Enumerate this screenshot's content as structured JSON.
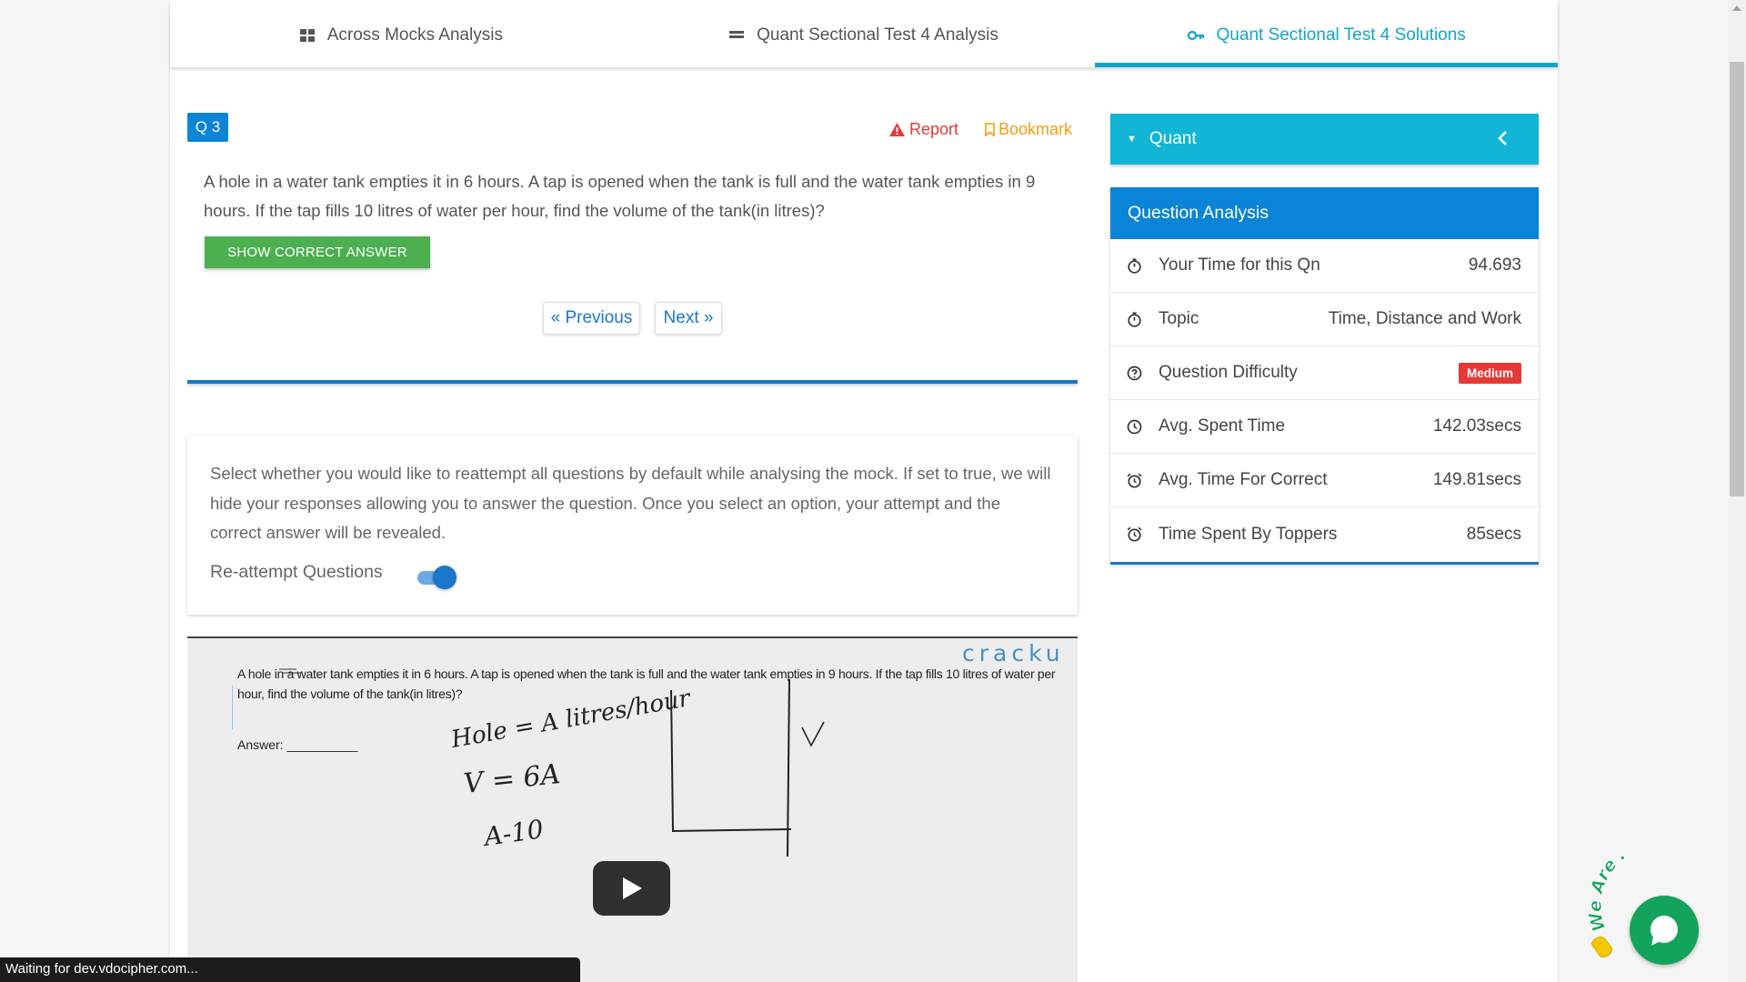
{
  "tabs": [
    {
      "label": "Across Mocks Analysis",
      "icon": "grid-icon"
    },
    {
      "label": "Quant Sectional Test 4 Analysis",
      "icon": "list-icon"
    },
    {
      "label": "Quant Sectional Test 4 Solutions",
      "icon": "key-icon",
      "active": true
    }
  ],
  "question": {
    "number": "Q 3",
    "report_label": "Report",
    "bookmark_label": "Bookmark",
    "text": "A hole in a water tank empties it in 6 hours. A tap is opened when the tank is full and the water tank empties in 9 hours. If the tap fills 10 litres of water per hour, find the volume of the tank(in litres)?",
    "show_answer_label": "SHOW CORRECT ANSWER",
    "prev_label": "« Previous",
    "next_label": "Next »"
  },
  "reattempt": {
    "description": "Select whether you would like to reattempt all questions by default while analysing the mock. If set to true, we will hide your responses allowing you to answer the question. Once you select an option, your attempt and the correct answer will be revealed.",
    "label": "Re-attempt Questions",
    "enabled": true
  },
  "video": {
    "logo": "cracku",
    "question_text": "A hole in a water tank empties it in 6 hours. A tap is opened when the tank is full and the water tank empties in 9 hours. If the tap fills 10 litres of water per hour, find the volume of the tank(in litres)?",
    "answer_label": "Answer: __________",
    "handwriting": [
      "Hole = A litres/hour",
      "V = 6A",
      "A-10",
      "V"
    ]
  },
  "sidebar": {
    "section_label": "Quant",
    "analysis_title": "Question Analysis",
    "rows": [
      {
        "label": "Your Time for this Qn",
        "value": "94.693",
        "icon": "stopwatch-icon"
      },
      {
        "label": "Topic",
        "value": "Time, Distance and Work",
        "icon": "stopwatch-icon"
      },
      {
        "label": "Question Difficulty",
        "value": "Medium",
        "icon": "help-circle-icon",
        "badge": true
      },
      {
        "label": "Avg. Spent Time",
        "value": "142.03secs",
        "icon": "clock-icon"
      },
      {
        "label": "Avg. Time For Correct",
        "value": "149.81secs",
        "icon": "alarm-icon"
      },
      {
        "label": "Time Spent By Toppers",
        "value": "85secs",
        "icon": "alarm-icon"
      }
    ]
  },
  "status_bar": "Waiting for dev.vdocipher.com...",
  "chat_widget": {
    "label": "We Are Here!"
  },
  "colors": {
    "accent_cyan": "#12b5d6",
    "primary_blue": "#0a84d6",
    "success_green": "#4caf50",
    "danger_red": "#e53935",
    "warning_orange": "#f39c12",
    "chat_green": "#13a35a"
  }
}
